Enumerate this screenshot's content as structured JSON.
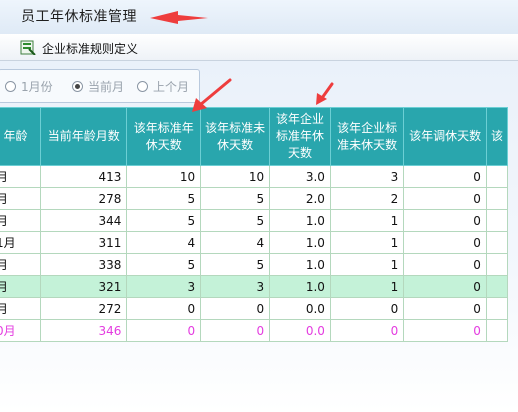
{
  "window": {
    "title": "员工年休标准管理"
  },
  "toolbar": {
    "button_label": "企业标准规则定义",
    "button_icon": "rule-definition-icon"
  },
  "filter": {
    "options": [
      {
        "label": "1月份",
        "selected": false
      },
      {
        "label": "当前月",
        "selected": true
      },
      {
        "label": "上个月",
        "selected": false
      }
    ]
  },
  "table": {
    "headers": [
      "年龄",
      "当前年龄月数",
      "该年标准年休天数",
      "该年标准未休天数",
      "该年企业标准年休天数",
      "该年企业标准未休天数",
      "该年调休天数",
      "该"
    ],
    "rows": [
      [
        "月",
        "413",
        "10",
        "10",
        "3.0",
        "3",
        "0"
      ],
      [
        "月",
        "278",
        "5",
        "5",
        "2.0",
        "2",
        "0"
      ],
      [
        "月",
        "344",
        "5",
        "5",
        "1.0",
        "1",
        "0"
      ],
      [
        "1月",
        "311",
        "4",
        "4",
        "1.0",
        "1",
        "0"
      ],
      [
        "月",
        "338",
        "5",
        "5",
        "1.0",
        "1",
        "0"
      ],
      [
        "月",
        "321",
        "3",
        "3",
        "1.0",
        "1",
        "0"
      ],
      [
        "月",
        "272",
        "0",
        "0",
        "0.0",
        "0",
        "0"
      ],
      [
        "0月",
        "346",
        "0",
        "0",
        "0.0",
        "0",
        "0"
      ]
    ],
    "selected_row": 5,
    "highlighted_row": 7
  },
  "colors": {
    "header_bg": "#29a6ad",
    "selected_row_bg": "#c4f2d8",
    "highlight_text": "#e43ce0",
    "annotation_arrow": "#ee3d3d"
  }
}
